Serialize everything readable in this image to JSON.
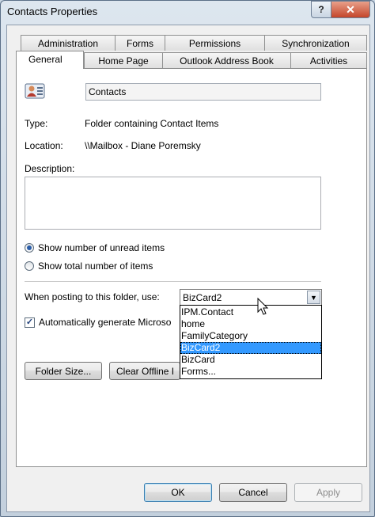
{
  "window": {
    "title": "Contacts Properties"
  },
  "titlebar": {
    "help_label": "?",
    "close_label": "✕"
  },
  "tabs_row1": [
    "Administration",
    "Forms",
    "Permissions",
    "Synchronization"
  ],
  "tabs_row2": [
    "General",
    "Home Page",
    "Outlook Address Book",
    "Activities"
  ],
  "active_tab": "General",
  "general": {
    "folder_name": "Contacts",
    "type_label": "Type:",
    "type_value": "Folder containing Contact Items",
    "location_label": "Location:",
    "location_value": "\\\\Mailbox - Diane Poremsky",
    "description_label": "Description:",
    "description_value": "",
    "radio_unread": "Show number of unread items",
    "radio_total": "Show total number of items",
    "radio_selected": "unread",
    "posting_label": "When posting to this folder, use:",
    "posting_selected": "BizCard2",
    "posting_options": [
      "IPM.Contact",
      "home",
      "FamilyCategory",
      "BizCard2",
      "BizCard",
      "Forms..."
    ],
    "auto_generate_label": "Automatically generate Microso",
    "auto_generate_checked": true,
    "folder_size_button": "Folder Size...",
    "clear_offline_button": "Clear Offline I"
  },
  "footer": {
    "ok": "OK",
    "cancel": "Cancel",
    "apply": "Apply"
  },
  "colors": {
    "selection": "#3399ff",
    "close_button": "#c4452a"
  },
  "icons": {
    "folder_icon": "contact-card-icon",
    "dropdown": "chevron-down-icon",
    "cursor": "mouse-pointer-icon"
  }
}
